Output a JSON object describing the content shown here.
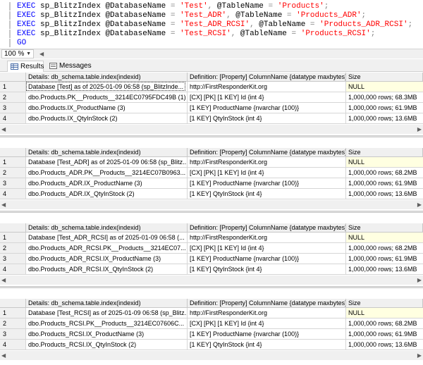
{
  "editor": {
    "lines": [
      [
        {
          "t": "EXEC",
          "c": "kw"
        },
        {
          "t": " sp_BlitzIndex @DatabaseName ",
          "c": ""
        },
        {
          "t": "=",
          "c": "gray"
        },
        {
          "t": " ",
          "c": ""
        },
        {
          "t": "'Test'",
          "c": "str"
        },
        {
          "t": ",",
          "c": "gray"
        },
        {
          "t": " @TableName ",
          "c": ""
        },
        {
          "t": "=",
          "c": "gray"
        },
        {
          "t": " ",
          "c": ""
        },
        {
          "t": "'Products'",
          "c": "str"
        },
        {
          "t": ";",
          "c": "gray"
        }
      ],
      [
        {
          "t": "EXEC",
          "c": "kw"
        },
        {
          "t": " sp_BlitzIndex @DatabaseName ",
          "c": ""
        },
        {
          "t": "=",
          "c": "gray"
        },
        {
          "t": " ",
          "c": ""
        },
        {
          "t": "'Test_ADR'",
          "c": "str"
        },
        {
          "t": ",",
          "c": "gray"
        },
        {
          "t": " @TableName ",
          "c": ""
        },
        {
          "t": "=",
          "c": "gray"
        },
        {
          "t": " ",
          "c": ""
        },
        {
          "t": "'Products_ADR'",
          "c": "str"
        },
        {
          "t": ";",
          "c": "gray"
        }
      ],
      [
        {
          "t": "EXEC",
          "c": "kw"
        },
        {
          "t": " sp_BlitzIndex @DatabaseName ",
          "c": ""
        },
        {
          "t": "=",
          "c": "gray"
        },
        {
          "t": " ",
          "c": ""
        },
        {
          "t": "'Test_ADR_RCSI'",
          "c": "str"
        },
        {
          "t": ",",
          "c": "gray"
        },
        {
          "t": " @TableName ",
          "c": ""
        },
        {
          "t": "=",
          "c": "gray"
        },
        {
          "t": " ",
          "c": ""
        },
        {
          "t": "'Products_ADR_RCSI'",
          "c": "str"
        },
        {
          "t": ";",
          "c": "gray"
        }
      ],
      [
        {
          "t": "EXEC",
          "c": "kw"
        },
        {
          "t": " sp_BlitzIndex @DatabaseName ",
          "c": ""
        },
        {
          "t": "=",
          "c": "gray"
        },
        {
          "t": " ",
          "c": ""
        },
        {
          "t": "'Test_RCSI'",
          "c": "str"
        },
        {
          "t": ",",
          "c": "gray"
        },
        {
          "t": " @TableName ",
          "c": ""
        },
        {
          "t": "=",
          "c": "gray"
        },
        {
          "t": " ",
          "c": ""
        },
        {
          "t": "'Products_RCSI'",
          "c": "str"
        },
        {
          "t": ";",
          "c": "gray"
        }
      ],
      [
        {
          "t": "GO",
          "c": "kw"
        }
      ]
    ]
  },
  "zoom": {
    "value": "100 %"
  },
  "tabs": {
    "results": "Results",
    "messages": "Messages"
  },
  "columns": [
    "Details: db_schema.table.index(indexid)",
    "Definition: [Property] ColumnName {datatype maxbytes}",
    "Size"
  ],
  "grids": [
    {
      "rows": [
        [
          "1",
          "Database [Test] as of 2025-01-09 06:58 (sp_BlitzInde...",
          "http://FirstResponderKit.org",
          "NULL"
        ],
        [
          "2",
          "dbo.Products.PK__Products__3214EC0795FDC49B (1)",
          "[CX] [PK] [1 KEY] Id {int 4}",
          "1,000,000 rows; 68.3MB"
        ],
        [
          "3",
          "dbo.Products.IX_ProductName (3)",
          "[1 KEY] ProductName {nvarchar (100)}",
          "1,000,000 rows; 61.9MB"
        ],
        [
          "4",
          "dbo.Products.IX_QtyInStock (2)",
          "[1 KEY] QtyInStock {int 4}",
          "1,000,000 rows; 13.6MB"
        ]
      ]
    },
    {
      "rows": [
        [
          "1",
          "Database [Test_ADR] as of 2025-01-09 06:58 (sp_Blitz...",
          "http://FirstResponderKit.org",
          "NULL"
        ],
        [
          "2",
          "dbo.Products_ADR.PK__Products__3214EC07B0963...",
          "[CX] [PK] [1 KEY] Id {int 4}",
          "1,000,000 rows; 68.2MB"
        ],
        [
          "3",
          "dbo.Products_ADR.IX_ProductName (3)",
          "[1 KEY] ProductName {nvarchar (100)}",
          "1,000,000 rows; 61.9MB"
        ],
        [
          "4",
          "dbo.Products_ADR.IX_QtyInStock (2)",
          "[1 KEY] QtyInStock {int 4}",
          "1,000,000 rows; 13.6MB"
        ]
      ]
    },
    {
      "rows": [
        [
          "1",
          "Database [Test_ADR_RCSI] as of 2025-01-09 06:58 (...",
          "http://FirstResponderKit.org",
          "NULL"
        ],
        [
          "2",
          "dbo.Products_ADR_RCSI.PK__Products__3214EC07...",
          "[CX] [PK] [1 KEY] Id {int 4}",
          "1,000,000 rows; 68.2MB"
        ],
        [
          "3",
          "dbo.Products_ADR_RCSI.IX_ProductName (3)",
          "[1 KEY] ProductName {nvarchar (100)}",
          "1,000,000 rows; 61.9MB"
        ],
        [
          "4",
          "dbo.Products_ADR_RCSI.IX_QtyInStock (2)",
          "[1 KEY] QtyInStock {int 4}",
          "1,000,000 rows; 13.6MB"
        ]
      ]
    },
    {
      "rows": [
        [
          "1",
          "Database [Test_RCSI] as of 2025-01-09 06:58 (sp_Blitz...",
          "http://FirstResponderKit.org",
          "NULL"
        ],
        [
          "2",
          "dbo.Products_RCSI.PK__Products__3214EC07606C...",
          "[CX] [PK] [1 KEY] Id {int 4}",
          "1,000,000 rows; 68.2MB"
        ],
        [
          "3",
          "dbo.Products_RCSI.IX_ProductName (3)",
          "[1 KEY] ProductName {nvarchar (100)}",
          "1,000,000 rows; 61.9MB"
        ],
        [
          "4",
          "dbo.Products_RCSI.IX_QtyInStock (2)",
          "[1 KEY] QtyInStock {int 4}",
          "1,000,000 rows; 13.6MB"
        ]
      ]
    }
  ],
  "colors": {
    "null_highlight": "#ffffe1",
    "keyword": "#0000ff",
    "string": "#ff0000",
    "chrome": "#f0f0f0"
  },
  "icons": {
    "results": "grid-icon",
    "messages": "messages-icon",
    "zoom": "chevron-down-icon",
    "scroll": "arrow-icon"
  }
}
